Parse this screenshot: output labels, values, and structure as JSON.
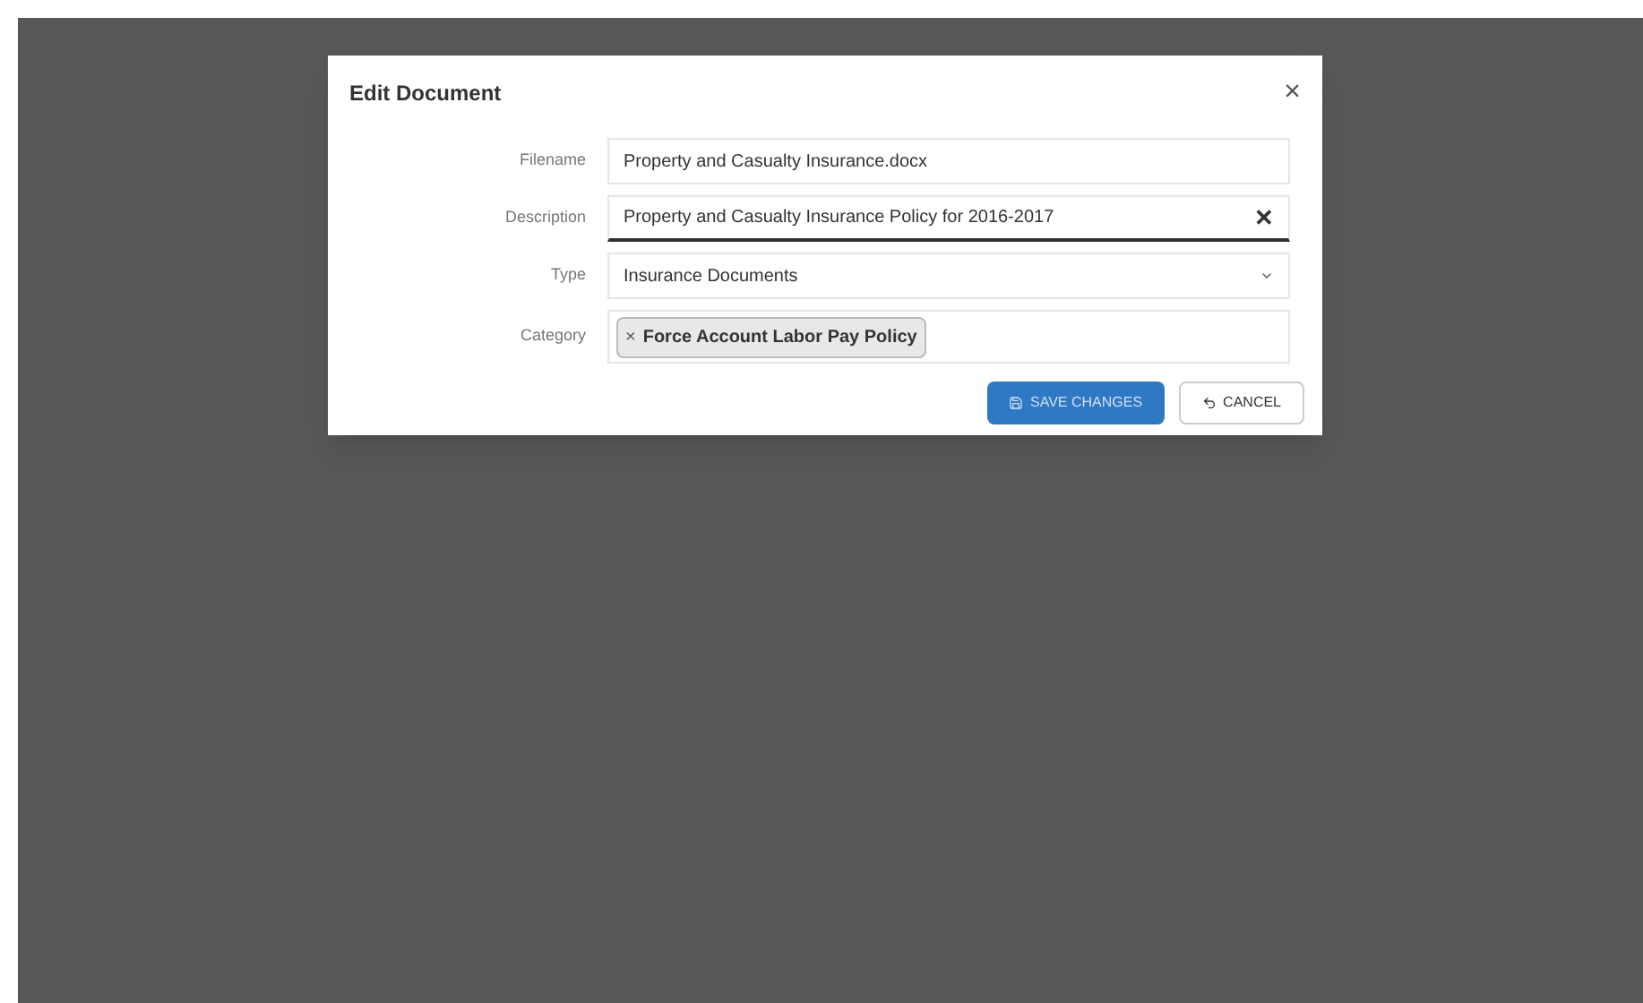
{
  "dialog": {
    "title": "Edit Document",
    "close": "×",
    "fields": [
      {
        "kind": "text",
        "label": "Filename",
        "value": "Property and Casualty Insurance.docx",
        "focused": false
      },
      {
        "kind": "text",
        "label": "Description",
        "value": "Property and Casualty Insurance Policy for 2016-2017",
        "focused": true,
        "clear": "✕"
      },
      {
        "kind": "select",
        "label": "Type",
        "value": "Insurance Documents"
      },
      {
        "kind": "tags",
        "label": "Category",
        "tags": [
          {
            "remove": "×",
            "label": "Force Account Labor Pay Policy"
          }
        ]
      }
    ],
    "buttons": [
      {
        "kind": "primary",
        "label": "SAVE CHANGES"
      },
      {
        "kind": "secondary",
        "label": "CANCEL"
      }
    ]
  }
}
